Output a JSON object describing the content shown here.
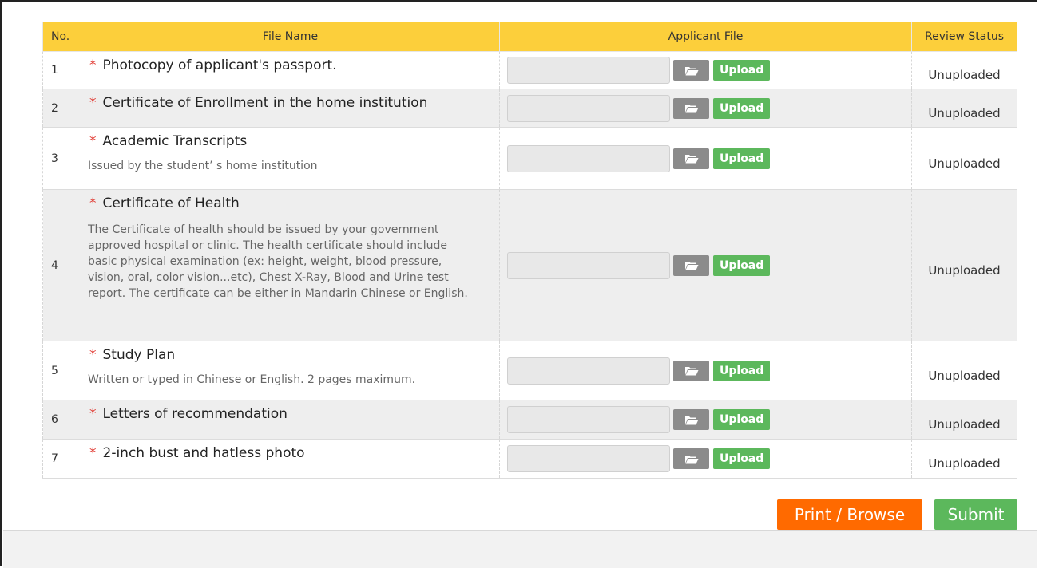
{
  "table": {
    "headers": {
      "no": "No.",
      "file_name": "File Name",
      "applicant_file": "Applicant File",
      "review_status": "Review Status"
    },
    "rows": [
      {
        "no": "1",
        "required": "*",
        "name": "Photocopy of applicant's passport.",
        "description": "",
        "upload_label": "Upload",
        "status": "Unuploaded"
      },
      {
        "no": "2",
        "required": "*",
        "name": "Certificate of Enrollment in the home institution",
        "description": "",
        "upload_label": "Upload",
        "status": "Unuploaded"
      },
      {
        "no": "3",
        "required": "*",
        "name": "Academic Transcripts",
        "description": "Issued by the student’ s home institution",
        "upload_label": "Upload",
        "status": "Unuploaded"
      },
      {
        "no": "4",
        "required": "*",
        "name": "Certificate of Health",
        "description": "The Certificate of health should be issued by your government approved hospital or clinic. The health certificate should include basic physical examination (ex: height, weight, blood pressure, vision, oral, color vision...etc), Chest X-Ray, Blood and Urine test report. The certificate can be either in Mandarin Chinese or English.",
        "upload_label": "Upload",
        "status": "Unuploaded"
      },
      {
        "no": "5",
        "required": "*",
        "name": "Study Plan",
        "description": "Written or typed in Chinese or English. 2 pages maximum.",
        "upload_label": "Upload",
        "status": "Unuploaded"
      },
      {
        "no": "6",
        "required": "*",
        "name": "Letters of recommendation",
        "description": "",
        "upload_label": "Upload",
        "status": "Unuploaded"
      },
      {
        "no": "7",
        "required": "*",
        "name": "2-inch bust and hatless photo",
        "description": "",
        "upload_label": "Upload",
        "status": "Unuploaded"
      }
    ]
  },
  "actions": {
    "print_label": "Print / Browse",
    "submit_label": "Submit"
  },
  "icons": {
    "browse": "folder-open-icon"
  },
  "colors": {
    "header_bg": "#fccf3b",
    "upload_green": "#5cb85c",
    "print_orange": "#ff6a00",
    "browse_gray": "#8b8b8b",
    "required_red": "#e0332b"
  }
}
